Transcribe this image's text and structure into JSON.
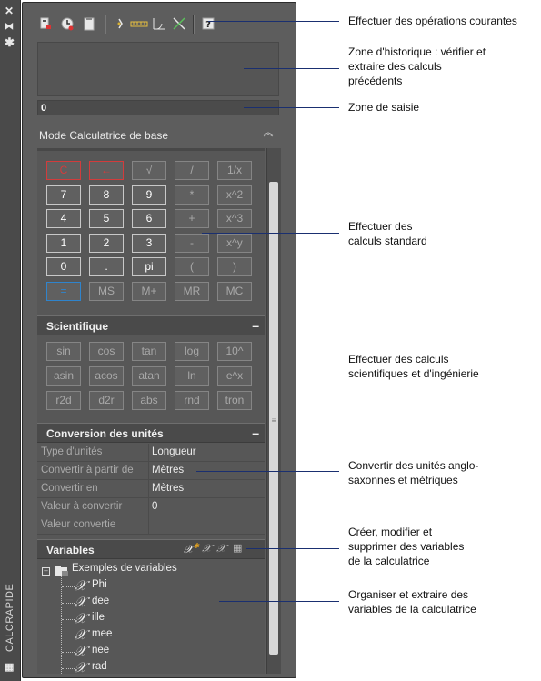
{
  "palette": {
    "title": "CALCRAPIDE",
    "controls": [
      "close-icon",
      "autohide-icon",
      "properties-icon"
    ]
  },
  "toolbar": {
    "icons": [
      "clear-icon",
      "history-icon",
      "paste-icon",
      "getcoords-icon",
      "distance-icon",
      "angle-icon",
      "intersection-icon",
      "help-icon"
    ]
  },
  "input": {
    "value": "0"
  },
  "mode": {
    "label": "Mode Calculatrice de base",
    "collapse_glyph": "︽"
  },
  "keypad": {
    "rows": [
      [
        "C",
        "←",
        "√",
        "/",
        "1/x"
      ],
      [
        "7",
        "8",
        "9",
        "*",
        "x^2"
      ],
      [
        "4",
        "5",
        "6",
        "+",
        "x^3"
      ],
      [
        "1",
        "2",
        "3",
        "-",
        "x^y"
      ],
      [
        "0",
        ".",
        "pi",
        "(",
        ")"
      ],
      [
        "=",
        "MS",
        "M+",
        "MR",
        "MC"
      ]
    ]
  },
  "scientific": {
    "title": "Scientifique",
    "toggle": "–",
    "rows": [
      [
        "sin",
        "cos",
        "tan",
        "log",
        "10^"
      ],
      [
        "asin",
        "acos",
        "atan",
        "ln",
        "e^x"
      ],
      [
        "r2d",
        "d2r",
        "abs",
        "rnd",
        "tron"
      ]
    ]
  },
  "conversion": {
    "title": "Conversion des unités",
    "toggle": "–",
    "rows": [
      {
        "label": "Type d'unités",
        "value": "Longueur"
      },
      {
        "label": "Convertir à partir de",
        "value": "Mètres"
      },
      {
        "label": "Convertir en",
        "value": "Mètres"
      },
      {
        "label": "Valeur à convertir",
        "value": "0"
      },
      {
        "label": "Valeur convertie",
        "value": ""
      }
    ]
  },
  "variables": {
    "title": "Variables",
    "toolbar": [
      "new-variable-icon",
      "edit-variable-icon",
      "delete-variable-icon",
      "calculator-icon"
    ],
    "group": "Exemples de variables",
    "items": [
      "Phi",
      "dee",
      "ille",
      "mee",
      "nee",
      "rad"
    ]
  },
  "annotations": [
    "Effectuer des opérations courantes",
    "Zone d'historique : vérifier et\nextraire des calculs\nprécédents",
    "Zone de saisie",
    "Effectuer des\ncalculs standard",
    "Effectuer des calculs\nscientifiques et d'ingénierie",
    "Convertir des unités anglo-\nsaxonnes et métriques",
    "Créer, modifier et\nsupprimer des variables\nde la calculatrice",
    "Organiser et extraire des\nvariables de la calculatrice"
  ]
}
